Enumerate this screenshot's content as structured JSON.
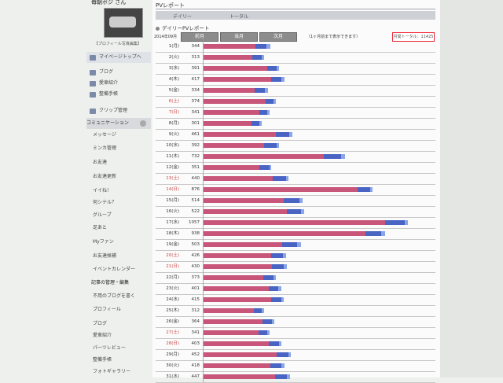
{
  "sidebar": {
    "username": "毎朝ポジ さん",
    "profile_link": "【プロフィール写真編集】",
    "items": [
      {
        "label": "マイページトップへ",
        "kind": "current",
        "icon": "triangle-icon"
      },
      {
        "label": "ブログ",
        "kind": "link",
        "icon": "blog-icon"
      },
      {
        "label": "愛車紹介",
        "kind": "link",
        "icon": "car-icon"
      },
      {
        "label": "整備手帳",
        "kind": "link",
        "icon": "notebook-icon"
      },
      {
        "label": "クリップ管理",
        "kind": "link",
        "icon": "clip-icon"
      },
      {
        "label": "コミュニケーション",
        "kind": "section",
        "icon": ""
      },
      {
        "label": "メッセージ",
        "kind": "sub",
        "icon": ""
      },
      {
        "label": "ミンカ管理",
        "kind": "sub",
        "icon": ""
      },
      {
        "label": "お友達",
        "kind": "sub",
        "icon": ""
      },
      {
        "label": "お友達更新",
        "kind": "sub",
        "icon": ""
      },
      {
        "label": "イイね！",
        "kind": "sub",
        "icon": ""
      },
      {
        "label": "何シテル？",
        "kind": "sub",
        "icon": ""
      },
      {
        "label": "グループ",
        "kind": "sub",
        "icon": ""
      },
      {
        "label": "足あと",
        "kind": "sub",
        "icon": ""
      },
      {
        "label": "Myファン",
        "kind": "sub",
        "icon": ""
      },
      {
        "label": "お友達候補",
        "kind": "sub",
        "icon": ""
      },
      {
        "label": "イベントカレンダー",
        "kind": "sub",
        "icon": ""
      },
      {
        "label": "記事の管理・編集",
        "kind": "heading",
        "icon": ""
      },
      {
        "label": "不用のブログを書く",
        "kind": "sub",
        "icon": ""
      },
      {
        "label": "プロフィール",
        "kind": "sub",
        "icon": ""
      },
      {
        "label": "ブログ",
        "kind": "sub",
        "icon": ""
      },
      {
        "label": "愛車紹介",
        "kind": "sub",
        "icon": ""
      },
      {
        "label": "パーツレビュー",
        "kind": "sub",
        "icon": ""
      },
      {
        "label": "整備手帳",
        "kind": "sub",
        "icon": ""
      },
      {
        "label": "フォトギャラリー",
        "kind": "sub",
        "icon": ""
      }
    ]
  },
  "main": {
    "title": "PVレポート",
    "tabs": [
      "デイリー",
      "トータル"
    ],
    "section_title": "デイリーPVレポート",
    "month_label": "2014年09月",
    "month_buttons": [
      "前月",
      "当月",
      "次月"
    ],
    "note": "（1ヶ月前まで表示できます）",
    "month_total": "月間トータル：11425"
  },
  "colors": {
    "pink": "#c8557a",
    "blue": "#4a64c4",
    "light_blue": "#8aa6e8",
    "highlight_border": "#e23333"
  },
  "chart_data": {
    "type": "bar",
    "orientation": "horizontal",
    "stacked": true,
    "max_value": 1057,
    "categories": [
      "1(月)",
      "2(火)",
      "3(水)",
      "4(木)",
      "5(金)",
      "6(土)",
      "7(日)",
      "8(月)",
      "9(火)",
      "10(水)",
      "11(木)",
      "12(金)",
      "13(土)",
      "14(日)",
      "15(月)",
      "16(火)",
      "17(水)",
      "18(木)",
      "19(金)",
      "20(土)",
      "21(日)",
      "22(月)",
      "23(火)",
      "24(水)",
      "25(木)",
      "26(金)",
      "27(土)",
      "28(日)",
      "29(月)",
      "30(火)",
      "31(水)"
    ],
    "weekend": [
      false,
      false,
      false,
      false,
      false,
      true,
      true,
      false,
      false,
      false,
      false,
      false,
      true,
      true,
      false,
      false,
      false,
      false,
      false,
      true,
      true,
      false,
      false,
      false,
      false,
      false,
      true,
      true,
      false,
      false,
      false
    ],
    "values": [
      344,
      313,
      391,
      417,
      334,
      374,
      341,
      301,
      461,
      392,
      732,
      351,
      440,
      876,
      514,
      522,
      1057,
      938,
      503,
      426,
      430,
      373,
      401,
      415,
      312,
      364,
      341,
      403,
      452,
      418,
      447
    ],
    "series": [
      {
        "values": [
          268,
          254,
          328,
          348,
          265,
          320,
          290,
          248,
          373,
          315,
          620,
          288,
          357,
          795,
          416,
          432,
          940,
          839,
          405,
          351,
          355,
          310,
          336,
          349,
          262,
          304,
          284,
          336,
          380,
          344,
          370
        ]
      },
      {
        "values": [
          58,
          47,
          52,
          55,
          52,
          40,
          41,
          42,
          70,
          62,
          92,
          52,
          68,
          65,
          80,
          72,
          100,
          81,
          80,
          60,
          60,
          52,
          52,
          52,
          40,
          50,
          45,
          55,
          60,
          60,
          62
        ]
      },
      {
        "values": [
          18,
          12,
          11,
          14,
          17,
          14,
          10,
          11,
          18,
          15,
          20,
          11,
          15,
          16,
          18,
          18,
          17,
          18,
          18,
          15,
          15,
          11,
          13,
          14,
          10,
          10,
          12,
          12,
          12,
          14,
          15
        ]
      }
    ]
  }
}
